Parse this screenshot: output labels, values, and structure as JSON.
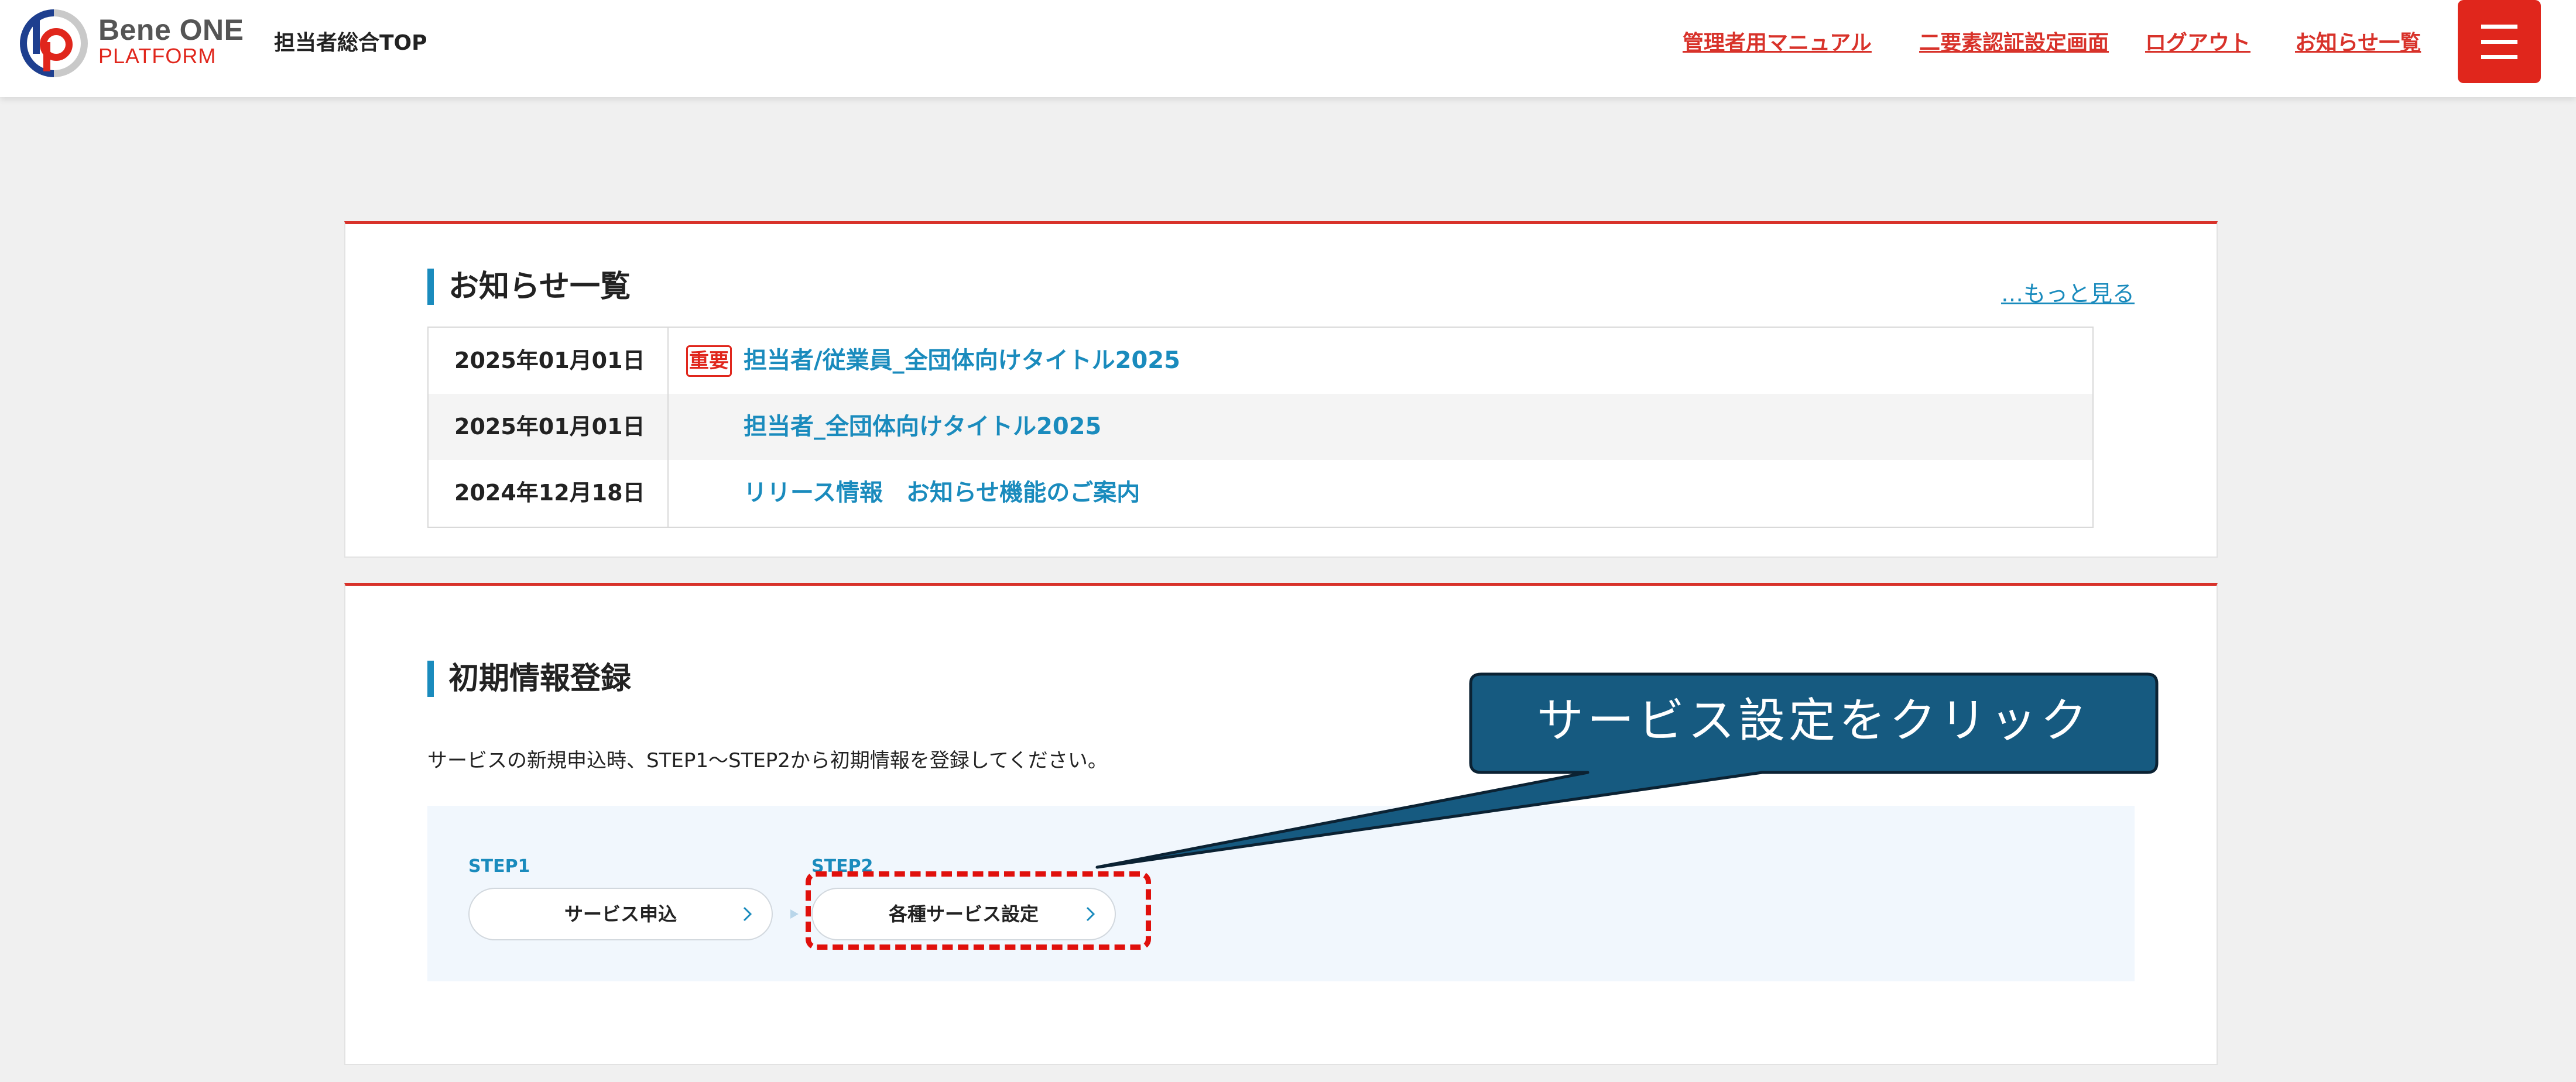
{
  "header": {
    "brand_name": "Bene ONE",
    "brand_sub": "PLATFORM",
    "page_title": "担当者総合TOP",
    "nav": [
      "管理者用マニュアル",
      "二要素認証設定画面",
      "ログアウト",
      "お知らせ一覧"
    ],
    "menu_icon": "hamburger-icon"
  },
  "news": {
    "heading": "お知らせ一覧",
    "more_link": "…もっと見る",
    "important_badge": "重要",
    "items": [
      {
        "date": "2025年01月01日",
        "title": "担当者/従業員_全団体向けタイトル2025",
        "important": true
      },
      {
        "date": "2025年01月01日",
        "title": "担当者_全団体向けタイトル2025",
        "important": false
      },
      {
        "date": "2024年12月18日",
        "title": "リリース情報　お知らせ機能のご案内",
        "important": false
      }
    ]
  },
  "initial": {
    "heading": "初期情報登録",
    "intro": "サービスの新規申込時、STEP1〜STEP2から初期情報を登録してください。",
    "steps": [
      {
        "label": "STEP1",
        "button": "サービス申込"
      },
      {
        "label": "STEP2",
        "button": "各種サービス設定"
      }
    ]
  },
  "callout": {
    "text": "サービス設定をクリック"
  },
  "colors": {
    "brand_red": "#e0261c",
    "link_blue": "#1a8bbd",
    "callout_fill": "#165a80",
    "panel_bg": "#f1f7fd"
  }
}
